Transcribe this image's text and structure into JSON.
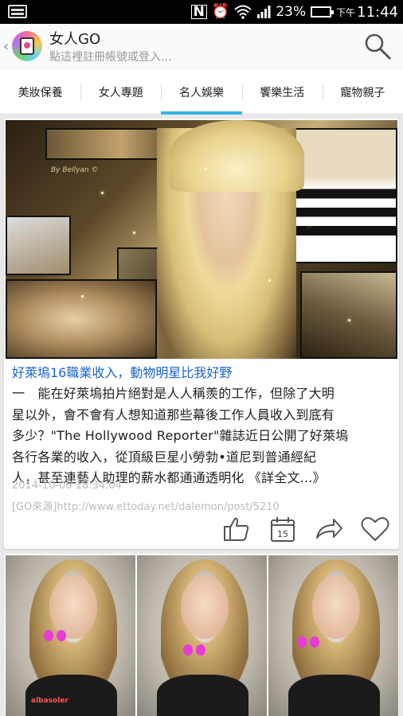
{
  "status_bar": {
    "battery_percent": "23%",
    "ampm": "下午",
    "time": "11:44",
    "nfc": "N"
  },
  "app_bar": {
    "title": "女人GO",
    "subtitle": "點這裡註冊帳號或登入..."
  },
  "tabs": [
    {
      "label": "美妝保養",
      "active": false
    },
    {
      "label": "女人專題",
      "active": false
    },
    {
      "label": "名人娛樂",
      "active": true
    },
    {
      "label": "饗樂生活",
      "active": false
    },
    {
      "label": "寵物親子",
      "active": false
    }
  ],
  "article": {
    "image_caption": "By Bellyan ©",
    "title": "好萊塢16職業收入，動物明星比我好野",
    "body_lines": [
      "一　能在好萊塢拍片絕對是人人稱羨的工作，但除了大明",
      "星以外，會不會有人想知道那些幕後工作人員收入到底有",
      "多少？\"The Hollywood Reporter\"雜誌近日公開了好萊塢",
      "各行各業的收入，從頂級巨星小勞勃•道尼到普通經紀",
      "人，甚至連藝人助理的薪水都通通透明化 《詳全文...》"
    ],
    "timestamp": "2014-10-06 18:34:04",
    "source": "[GO來源]http://www.ettoday.net/dalemon/post/5210",
    "calendar_day": "15"
  },
  "second_card": {
    "brand_text": "albasoler"
  },
  "colors": {
    "accent": "#33b5e5",
    "title_link": "#1a63c9",
    "meta_gray": "#bbbbbb"
  },
  "icons": [
    "signal-icon",
    "wifi-icon",
    "alarm-icon",
    "battery-icon",
    "search-icon",
    "like-icon",
    "calendar-icon",
    "share-icon",
    "heart-icon"
  ]
}
